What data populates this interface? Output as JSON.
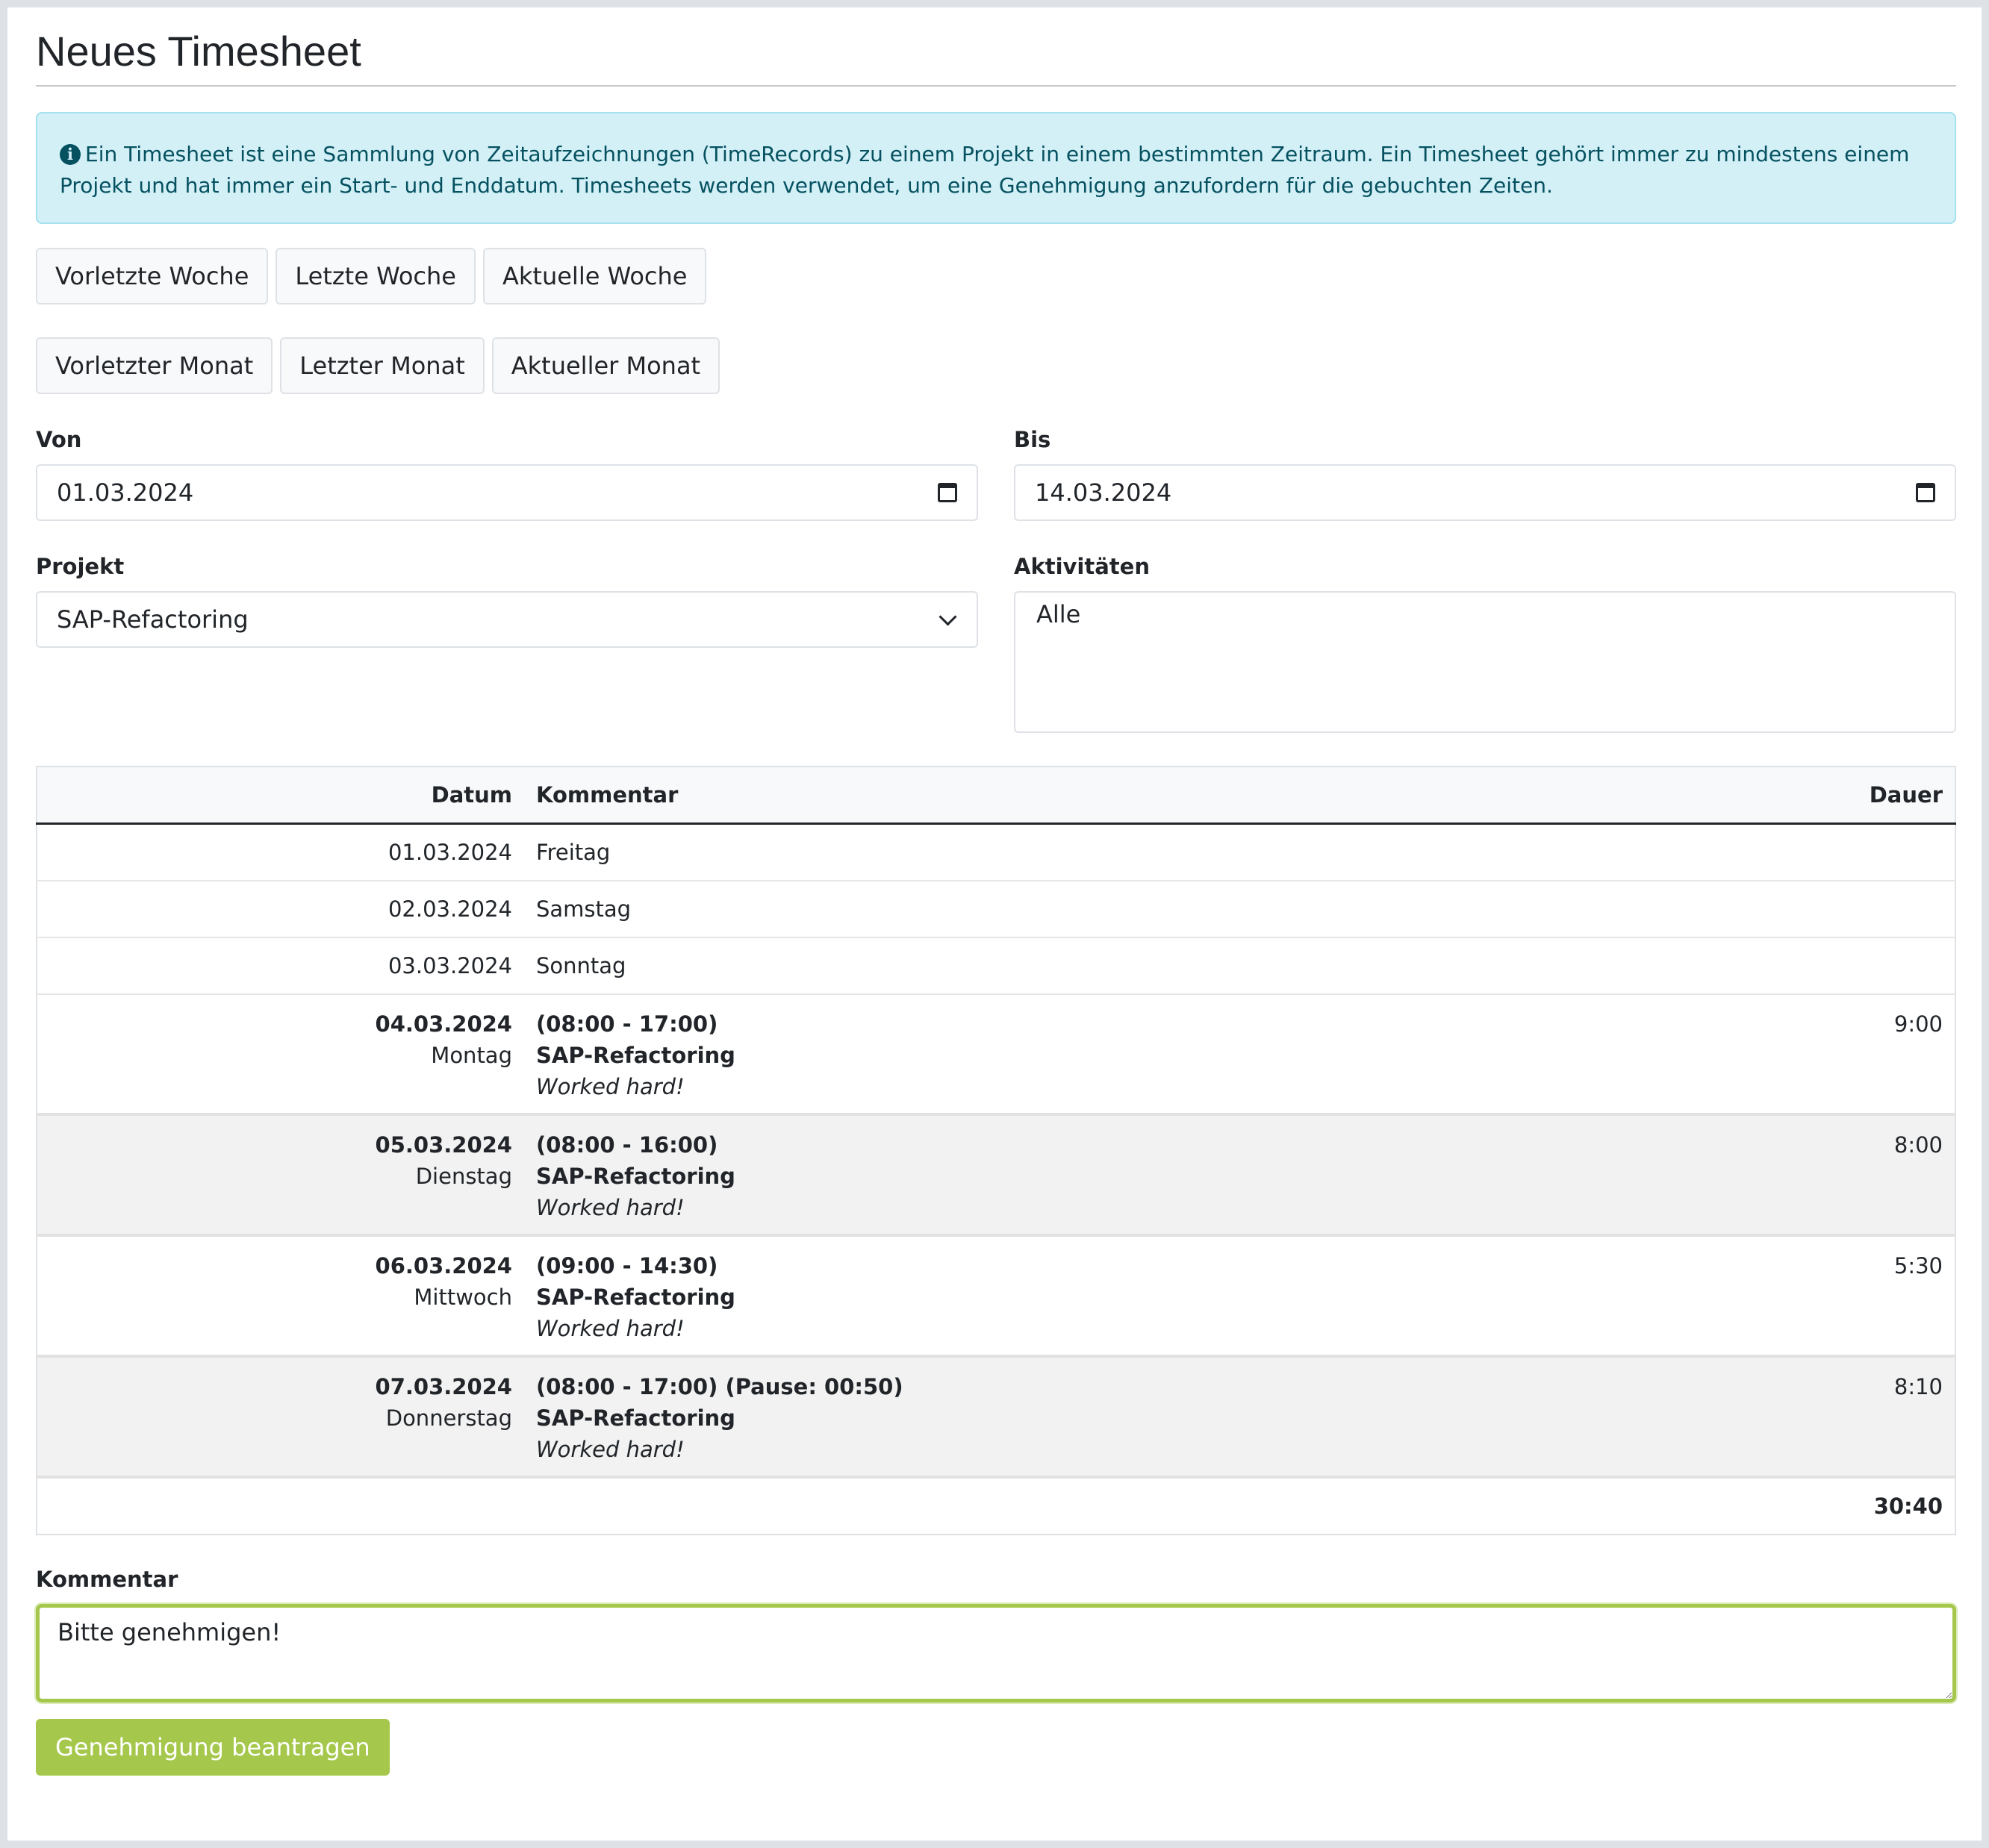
{
  "page_title": "Neues Timesheet",
  "info_text": "Ein Timesheet ist eine Sammlung von Zeitaufzeichnungen (TimeRecords) zu einem Projekt in einem bestimmten Zeitraum. Ein Timesheet gehört immer zu mindestens einem Projekt und hat immer ein Start- und Enddatum. Timesheets werden verwendet, um eine Genehmigung anzufordern für die gebuchten Zeiten.",
  "quick_weeks": [
    "Vorletzte Woche",
    "Letzte Woche",
    "Aktuelle Woche"
  ],
  "quick_months": [
    "Vorletzter Monat",
    "Letzter Monat",
    "Aktueller Monat"
  ],
  "von": {
    "label": "Von",
    "value": "01.03.2024"
  },
  "bis": {
    "label": "Bis",
    "value": "14.03.2024"
  },
  "projekt": {
    "label": "Projekt",
    "value": "SAP-Refactoring"
  },
  "aktivitaeten": {
    "label": "Aktivitäten",
    "value": "Alle"
  },
  "table": {
    "headers": {
      "datum": "Datum",
      "kommentar": "Kommentar",
      "dauer": "Dauer"
    },
    "simple_rows": [
      {
        "date": "01.03.2024",
        "day": "Freitag"
      },
      {
        "date": "02.03.2024",
        "day": "Samstag"
      },
      {
        "date": "03.03.2024",
        "day": "Sonntag"
      }
    ],
    "entries": [
      {
        "date": "04.03.2024",
        "day": "Montag",
        "time": "(08:00 - 17:00)",
        "project": "SAP-Refactoring",
        "comment": "Worked hard!",
        "duration": "9:00"
      },
      {
        "date": "05.03.2024",
        "day": "Dienstag",
        "time": "(08:00 - 16:00)",
        "project": "SAP-Refactoring",
        "comment": "Worked hard!",
        "duration": "8:00"
      },
      {
        "date": "06.03.2024",
        "day": "Mittwoch",
        "time": "(09:00 - 14:30)",
        "project": "SAP-Refactoring",
        "comment": "Worked hard!",
        "duration": "5:30"
      },
      {
        "date": "07.03.2024",
        "day": "Donnerstag",
        "time": "(08:00 - 17:00) (Pause: 00:50)",
        "project": "SAP-Refactoring",
        "comment": "Worked hard!",
        "duration": "8:10"
      }
    ],
    "total": "30:40"
  },
  "kommentar": {
    "label": "Kommentar",
    "value": "Bitte genehmigen!"
  },
  "submit_label": "Genehmigung beantragen",
  "colors": {
    "accent": "#a5c84c",
    "info_bg": "#d3f0f7",
    "info_text": "#055160"
  }
}
